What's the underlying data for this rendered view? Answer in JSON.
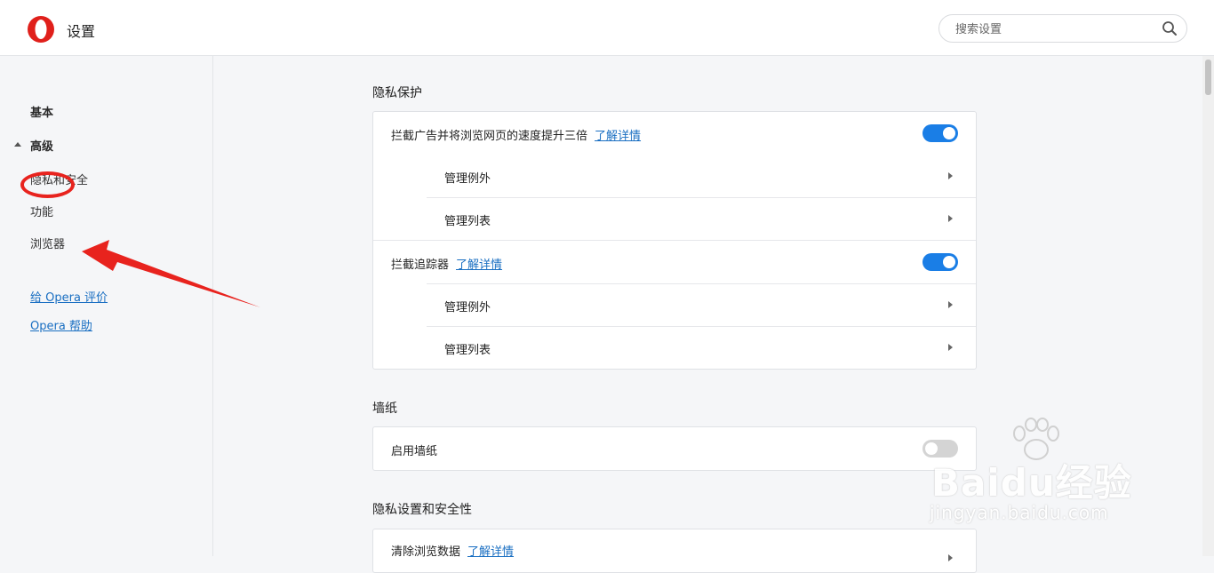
{
  "header": {
    "title": "设置",
    "search_placeholder": "搜索设置"
  },
  "sidebar": {
    "basic": "基本",
    "advanced": "高级",
    "items": [
      "隐私和安全",
      "功能",
      "浏览器"
    ],
    "links": [
      "给 Opera 评价",
      "Opera 帮助"
    ]
  },
  "sections": {
    "privacy": {
      "title": "隐私保护",
      "ad_block_label": "拦截广告并将浏览网页的速度提升三倍",
      "tracker_block_label": "拦截追踪器",
      "learn_more": "了解详情",
      "manage_exceptions": "管理例外",
      "manage_lists": "管理列表",
      "ad_block_enabled": true,
      "tracker_block_enabled": true
    },
    "wallpaper": {
      "title": "墙纸",
      "enable_label": "启用墙纸",
      "enabled": false
    },
    "privacy_security": {
      "title": "隐私设置和安全性",
      "clear_data_label": "清除浏览数据",
      "learn_more": "了解详情"
    }
  },
  "watermark": {
    "brand": "Baidu经验",
    "url": "jingyan.baidu.com"
  },
  "colors": {
    "accent": "#1a7ee6",
    "link": "#1a6fc2",
    "annotation": "#e8231e",
    "opera_red": "#e0201b"
  }
}
